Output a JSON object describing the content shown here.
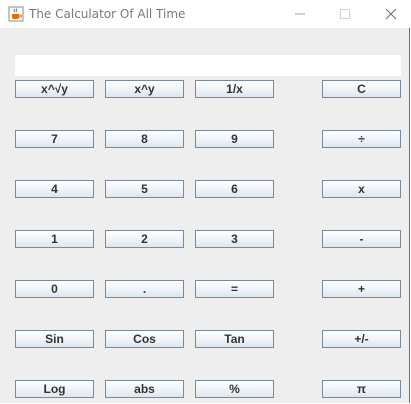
{
  "window": {
    "title": "The Calculator Of All Time",
    "app_icon": "java-cup-icon",
    "controls": [
      "minimize-icon",
      "maximize-icon",
      "close-icon"
    ]
  },
  "display": {
    "value": ""
  },
  "buttons": {
    "root": "x^√y",
    "power": "x^y",
    "reciprocal": "1/x",
    "clear": "C",
    "seven": "7",
    "eight": "8",
    "nine": "9",
    "divide": "÷",
    "four": "4",
    "five": "5",
    "six": "6",
    "multiply": "x",
    "one": "1",
    "two": "2",
    "three": "3",
    "subtract": "-",
    "zero": "0",
    "decimal": ".",
    "equals": "=",
    "add": "+",
    "sin": "Sin",
    "cos": "Cos",
    "tan": "Tan",
    "negate": "+/-",
    "log": "Log",
    "abs": "abs",
    "percent": "%",
    "pi": "π"
  }
}
